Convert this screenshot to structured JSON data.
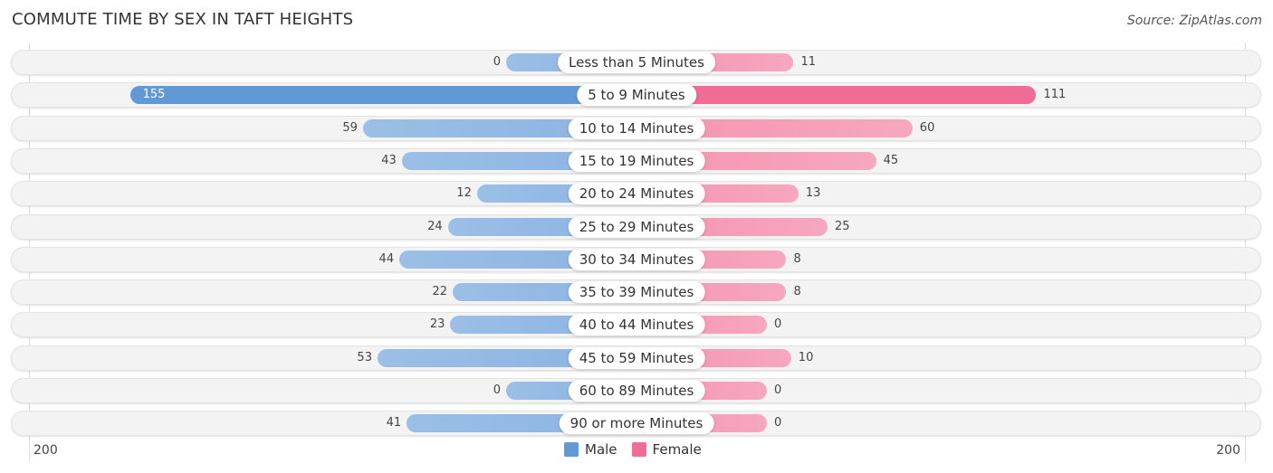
{
  "title": "COMMUTE TIME BY SEX IN TAFT HEIGHTS",
  "source": "Source: ZipAtlas.com",
  "chart_data": {
    "type": "bar",
    "orientation": "horizontal-diverging",
    "title": "COMMUTE TIME BY SEX IN TAFT HEIGHTS",
    "categories": [
      "Less than 5 Minutes",
      "5 to 9 Minutes",
      "10 to 14 Minutes",
      "15 to 19 Minutes",
      "20 to 24 Minutes",
      "25 to 29 Minutes",
      "30 to 34 Minutes",
      "35 to 39 Minutes",
      "40 to 44 Minutes",
      "45 to 59 Minutes",
      "60 to 89 Minutes",
      "90 or more Minutes"
    ],
    "series": [
      {
        "name": "Male",
        "color": "#6199d6",
        "values": [
          0,
          155,
          59,
          43,
          12,
          24,
          44,
          22,
          23,
          53,
          0,
          41
        ]
      },
      {
        "name": "Female",
        "color": "#f06b95",
        "values": [
          11,
          111,
          60,
          45,
          13,
          25,
          8,
          8,
          0,
          10,
          0,
          0
        ]
      }
    ],
    "axis": {
      "left_tick": "200",
      "right_tick": "200",
      "range": [
        0,
        200
      ]
    },
    "legend": {
      "position": "bottom-center",
      "items": [
        "Male",
        "Female"
      ]
    }
  }
}
